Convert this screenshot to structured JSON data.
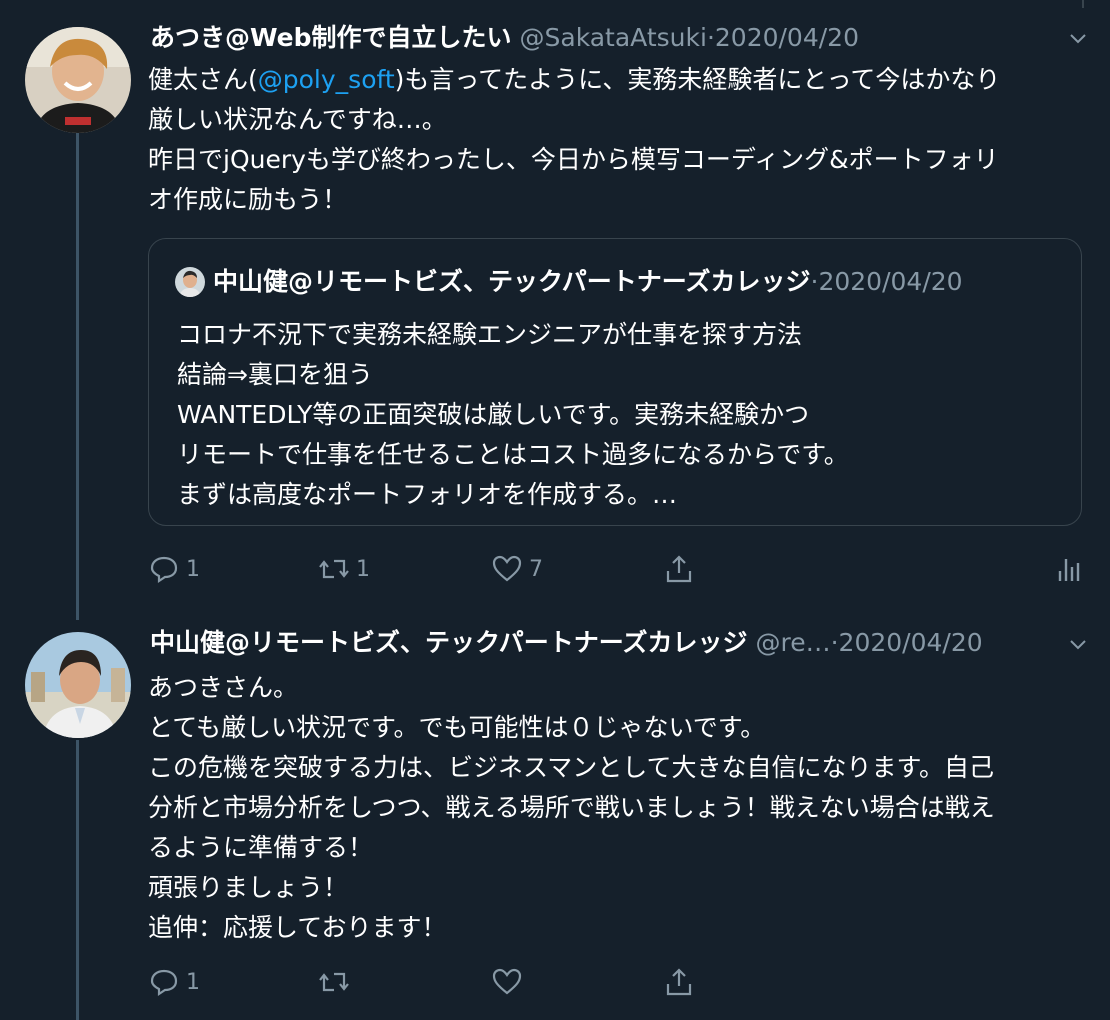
{
  "tweet1": {
    "name": "あつき@Web制作で自立したい",
    "handle": "@SakataAtsuki",
    "dot": "·",
    "date": "2020/04/20",
    "text_prefix": "健太さん(",
    "mention": "@poly_soft",
    "text_suffix": ")も言ってたように、実務未経験者にとって今はかなり",
    "line2": "厳しい状況なんですね…。",
    "line3": "昨日でjQueryも学び終わったし、今日から模写コーディング&ポートフォリ",
    "line4": "オ作成に励もう！",
    "actions": {
      "reply": "1",
      "retweet": "1",
      "like": "7"
    }
  },
  "quote": {
    "name": "中山健@リモートビズ、テックパートナーズカレッジ",
    "dot": "·",
    "date": "2020/04/20",
    "lines": [
      "コロナ不況下で実務未経験エンジニアが仕事を探す方法",
      "結論⇒裏口を狙う",
      "WANTEDLY等の正面突破は厳しいです。実務未経験かつ",
      "リモートで仕事を任せることはコスト過多になるからです。",
      "まずは高度なポートフォリオを作成する。…"
    ]
  },
  "tweet2": {
    "name": "中山健@リモートビズ、テックパートナーズカレッジ",
    "handle": "@re…",
    "dot": "·",
    "date": "2020/04/20",
    "lines": [
      "あつきさん。",
      "とても厳しい状況です。でも可能性は０じゃないです。",
      "この危機を突破する力は、ビジネスマンとして大きな自信になります。自己",
      "分析と市場分析をしつつ、戦える場所で戦いましょう！戦えない場合は戦え",
      "るように準備する！",
      "頑張りましょう！",
      "追伸：応援しております！"
    ],
    "actions": {
      "reply": "1",
      "retweet": "",
      "like": ""
    }
  },
  "icons": [
    "chevron-down-icon",
    "reply-icon",
    "retweet-icon",
    "like-icon",
    "share-icon",
    "analytics-icon"
  ],
  "colors": {
    "background": "#15202b",
    "muted": "#8899a6",
    "link": "#1da1f2",
    "border": "#38444d"
  }
}
